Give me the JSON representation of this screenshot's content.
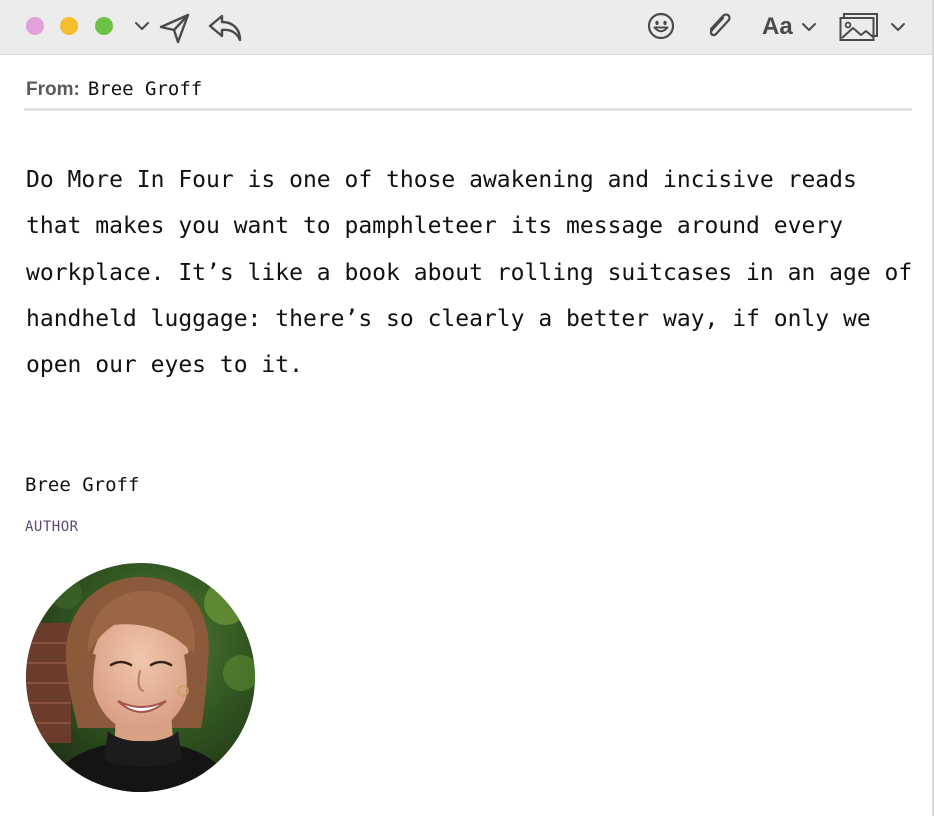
{
  "window": {
    "traffic_lights": {
      "close_color": "#e2a1d8",
      "minimize_color": "#f5be2f",
      "zoom_color": "#6cc244"
    }
  },
  "toolbar": {
    "left_icons": [
      "chevron-down-icon",
      "send-icon",
      "reply-icon"
    ],
    "right_icons": [
      "emoji-icon",
      "paperclip-icon",
      "format-text-icon",
      "chevron-down-icon",
      "photo-browser-icon",
      "chevron-down-icon"
    ],
    "format_label": "Aa"
  },
  "header": {
    "from_label": "From:",
    "from_value": "Bree Groff"
  },
  "message": {
    "body": "Do More In Four is one of those awakening and incisive reads that makes you want to pamphleteer its message around every workplace. It’s like a book about rolling suitcases in an age of handheld luggage: there’s so clearly a better way, if only we open our eyes to it."
  },
  "signature": {
    "name": "Bree Groff",
    "role": "AUTHOR",
    "role_color": "#5b4a73",
    "photo": "author-photo"
  }
}
